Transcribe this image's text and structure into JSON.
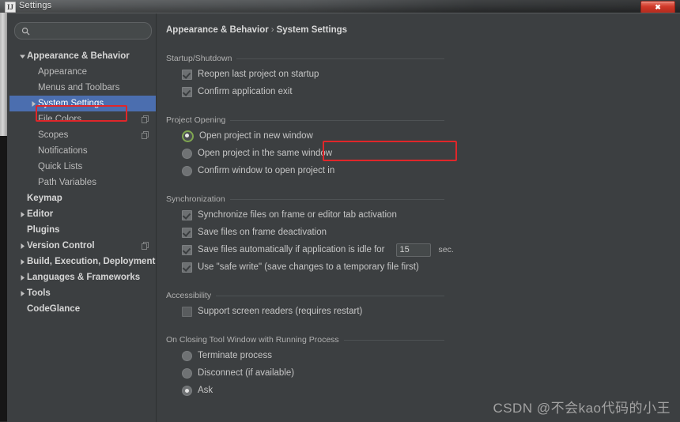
{
  "window": {
    "title": "Settings",
    "app_icon": "intellij-idea-icon",
    "close_label": "✖"
  },
  "colors": {
    "background": "#3c3f41",
    "selection_blue": "#4b6eaf",
    "annotation_red": "#e0262a",
    "radio_accent_green": "#7fa650",
    "text": "#c6c6c6"
  },
  "sidebar": {
    "search": {
      "value": "",
      "placeholder": ""
    },
    "items": [
      {
        "label": "Appearance & Behavior",
        "indent": 0,
        "twisty": "down",
        "bold": true,
        "selected": false,
        "trailing_icon": null
      },
      {
        "label": "Appearance",
        "indent": 1,
        "twisty": "none",
        "bold": false,
        "selected": false,
        "trailing_icon": null
      },
      {
        "label": "Menus and Toolbars",
        "indent": 1,
        "twisty": "none",
        "bold": false,
        "selected": false,
        "trailing_icon": null
      },
      {
        "label": "System Settings",
        "indent": 1,
        "twisty": "right",
        "bold": false,
        "selected": true,
        "trailing_icon": null
      },
      {
        "label": "File Colors",
        "indent": 1,
        "twisty": "none",
        "bold": false,
        "selected": false,
        "trailing_icon": "copy-icon"
      },
      {
        "label": "Scopes",
        "indent": 1,
        "twisty": "none",
        "bold": false,
        "selected": false,
        "trailing_icon": "copy-icon"
      },
      {
        "label": "Notifications",
        "indent": 1,
        "twisty": "none",
        "bold": false,
        "selected": false,
        "trailing_icon": null
      },
      {
        "label": "Quick Lists",
        "indent": 1,
        "twisty": "none",
        "bold": false,
        "selected": false,
        "trailing_icon": null
      },
      {
        "label": "Path Variables",
        "indent": 1,
        "twisty": "none",
        "bold": false,
        "selected": false,
        "trailing_icon": null
      },
      {
        "label": "Keymap",
        "indent": 0,
        "twisty": "none",
        "bold": true,
        "selected": false,
        "trailing_icon": null
      },
      {
        "label": "Editor",
        "indent": 0,
        "twisty": "right",
        "bold": true,
        "selected": false,
        "trailing_icon": null
      },
      {
        "label": "Plugins",
        "indent": 0,
        "twisty": "none",
        "bold": true,
        "selected": false,
        "trailing_icon": null
      },
      {
        "label": "Version Control",
        "indent": 0,
        "twisty": "right",
        "bold": true,
        "selected": false,
        "trailing_icon": "copy-icon"
      },
      {
        "label": "Build, Execution, Deployment",
        "indent": 0,
        "twisty": "right",
        "bold": true,
        "selected": false,
        "trailing_icon": null
      },
      {
        "label": "Languages & Frameworks",
        "indent": 0,
        "twisty": "right",
        "bold": true,
        "selected": false,
        "trailing_icon": null
      },
      {
        "label": "Tools",
        "indent": 0,
        "twisty": "right",
        "bold": true,
        "selected": false,
        "trailing_icon": null
      },
      {
        "label": "CodeGlance",
        "indent": 0,
        "twisty": "none",
        "bold": true,
        "selected": false,
        "trailing_icon": null
      }
    ]
  },
  "breadcrumb": {
    "root": "Appearance & Behavior",
    "separator": "›",
    "leaf": "System Settings"
  },
  "sections": {
    "startup": {
      "title": "Startup/Shutdown",
      "options": [
        {
          "label": "Reopen last project on startup",
          "checked": true
        },
        {
          "label": "Confirm application exit",
          "checked": true
        }
      ]
    },
    "project_opening": {
      "title": "Project Opening",
      "options": [
        {
          "label": "Open project in new window",
          "selected": true
        },
        {
          "label": "Open project in the same window",
          "selected": false
        },
        {
          "label": "Confirm window to open project in",
          "selected": false
        }
      ]
    },
    "synchronization": {
      "title": "Synchronization",
      "options": [
        {
          "label": "Synchronize files on frame or editor tab activation",
          "checked": true
        },
        {
          "label": "Save files on frame deactivation",
          "checked": true
        },
        {
          "label": "Save files automatically if application is idle for",
          "checked": true
        },
        {
          "label": "Use \"safe write\" (save changes to a temporary file first)",
          "checked": true
        }
      ],
      "idle_seconds": "15",
      "seconds_suffix": "sec."
    },
    "accessibility": {
      "title": "Accessibility",
      "options": [
        {
          "label": "Support screen readers (requires restart)",
          "checked": false
        }
      ]
    },
    "closing_tool_window": {
      "title": "On Closing Tool Window with Running Process",
      "options": [
        {
          "label": "Terminate process",
          "selected": false
        },
        {
          "label": "Disconnect (if available)",
          "selected": false
        },
        {
          "label": "Ask",
          "selected": true
        }
      ]
    }
  },
  "watermark": {
    "text": "CSDN @不会kao代码的小王"
  }
}
